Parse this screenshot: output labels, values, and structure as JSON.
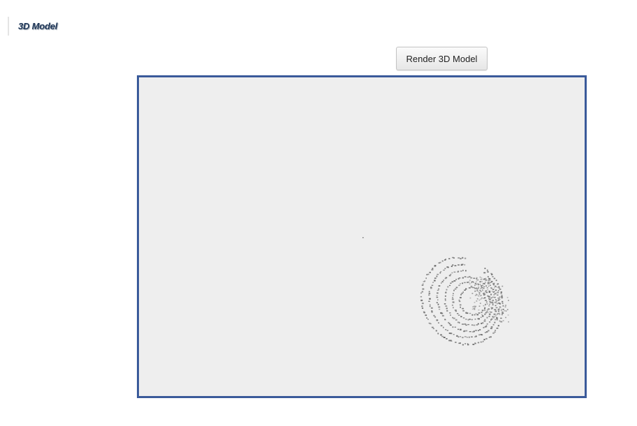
{
  "section": {
    "title": "3D Model"
  },
  "toolbar": {
    "render_label": "Render 3D Model"
  },
  "viewport": {
    "background_color": "#eeeeee",
    "border_color": "#3a5a9a",
    "point_color": "#6b6b6b"
  }
}
